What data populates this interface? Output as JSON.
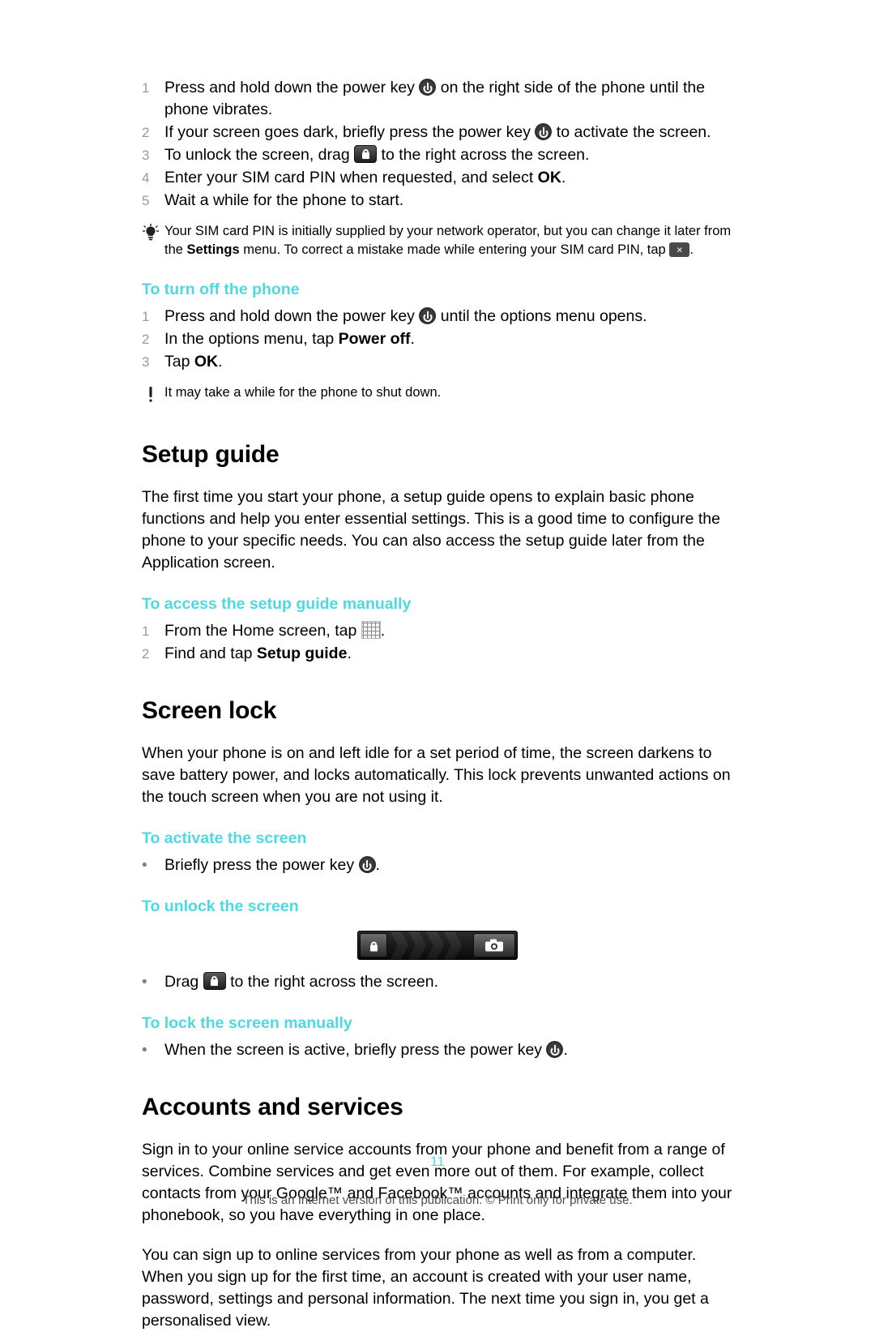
{
  "startup": {
    "steps": [
      {
        "num": "1",
        "pre": "Press and hold down the power key ",
        "icon": "power-key-icon",
        "post": " on the right side of the phone until the phone vibrates."
      },
      {
        "num": "2",
        "pre": "If your screen goes dark, briefly press the power key ",
        "icon": "power-key-icon",
        "post": " to activate the screen."
      },
      {
        "num": "3",
        "pre": "To unlock the screen, drag ",
        "icon": "lock-icon",
        "post": " to the right across the screen."
      },
      {
        "num": "4",
        "pre": "Enter your SIM card PIN when requested, and select ",
        "bold": "OK",
        "post": "."
      },
      {
        "num": "5",
        "pre": "Wait a while for the phone to start.",
        "post": ""
      }
    ],
    "tip": {
      "icon": "lightbulb-icon",
      "part1": "Your SIM card PIN is initially supplied by your network operator, but you can change it later from the ",
      "bold1": "Settings",
      "part2": " menu. To correct a mistake made while entering your SIM card PIN, tap ",
      "end_icon": "backspace-icon",
      "part3": "."
    }
  },
  "turn_off": {
    "heading": "To turn off the phone",
    "steps": [
      {
        "num": "1",
        "pre": "Press and hold down the power key ",
        "icon": "power-key-icon",
        "post": " until the options menu opens."
      },
      {
        "num": "2",
        "pre": "In the options menu, tap ",
        "bold": "Power off",
        "post": "."
      },
      {
        "num": "3",
        "pre": "Tap ",
        "bold": "OK",
        "post": "."
      }
    ],
    "note": {
      "icon": "exclamation-icon",
      "text": "It may take a while for the phone to shut down."
    }
  },
  "setup_guide": {
    "title": "Setup guide",
    "paragraph": "The first time you start your phone, a setup guide opens to explain basic phone functions and help you enter essential settings. This is a good time to configure the phone to your specific needs. You can also access the setup guide later from the Application screen.",
    "sub_heading": "To access the setup guide manually",
    "steps": [
      {
        "num": "1",
        "pre": "From the Home screen, tap ",
        "icon": "apps-grid-icon",
        "post": "."
      },
      {
        "num": "2",
        "pre": "Find and tap ",
        "bold": "Setup guide",
        "post": "."
      }
    ]
  },
  "screen_lock": {
    "title": "Screen lock",
    "paragraph": "When your phone is on and left idle for a set period of time, the screen darkens to save battery power, and locks automatically. This lock prevents unwanted actions on the touch screen when you are not using it.",
    "activate_heading": "To activate the screen",
    "activate_bullet": {
      "bullet": "•",
      "pre": "Briefly press the power key ",
      "icon": "power-key-icon",
      "post": "."
    },
    "unlock_heading": "To unlock the screen",
    "slider": {
      "name": "unlock-slider-image",
      "left_icon": "lock-icon",
      "right_icon": "camera-icon"
    },
    "unlock_bullet": {
      "bullet": "•",
      "pre": "Drag ",
      "icon": "lock-icon",
      "post": " to the right across the screen."
    },
    "lock_heading": "To lock the screen manually",
    "lock_bullet": {
      "bullet": "•",
      "pre": "When the screen is active, briefly press the power key ",
      "icon": "power-key-icon",
      "post": "."
    }
  },
  "accounts": {
    "title": "Accounts and services",
    "paragraph1": "Sign in to your online service accounts from your phone and benefit from a range of services. Combine services and get even more out of them. For example, collect contacts from your Google™ and Facebook™ accounts and integrate them into your phonebook, so you have everything in one place.",
    "paragraph2": "You can sign up to online services from your phone as well as from a computer. When you sign up for the first time, an account is created with your user name, password, settings and personal information. The next time you sign in, you get a personalised view."
  },
  "footer": {
    "page_number": "11",
    "disclaimer": "This is an Internet version of this publication. © Print only for private use."
  },
  "colors": {
    "accent": "#4fd8e0",
    "number_gray": "#9a9a9a",
    "footer_gray": "#4b4b4b"
  }
}
